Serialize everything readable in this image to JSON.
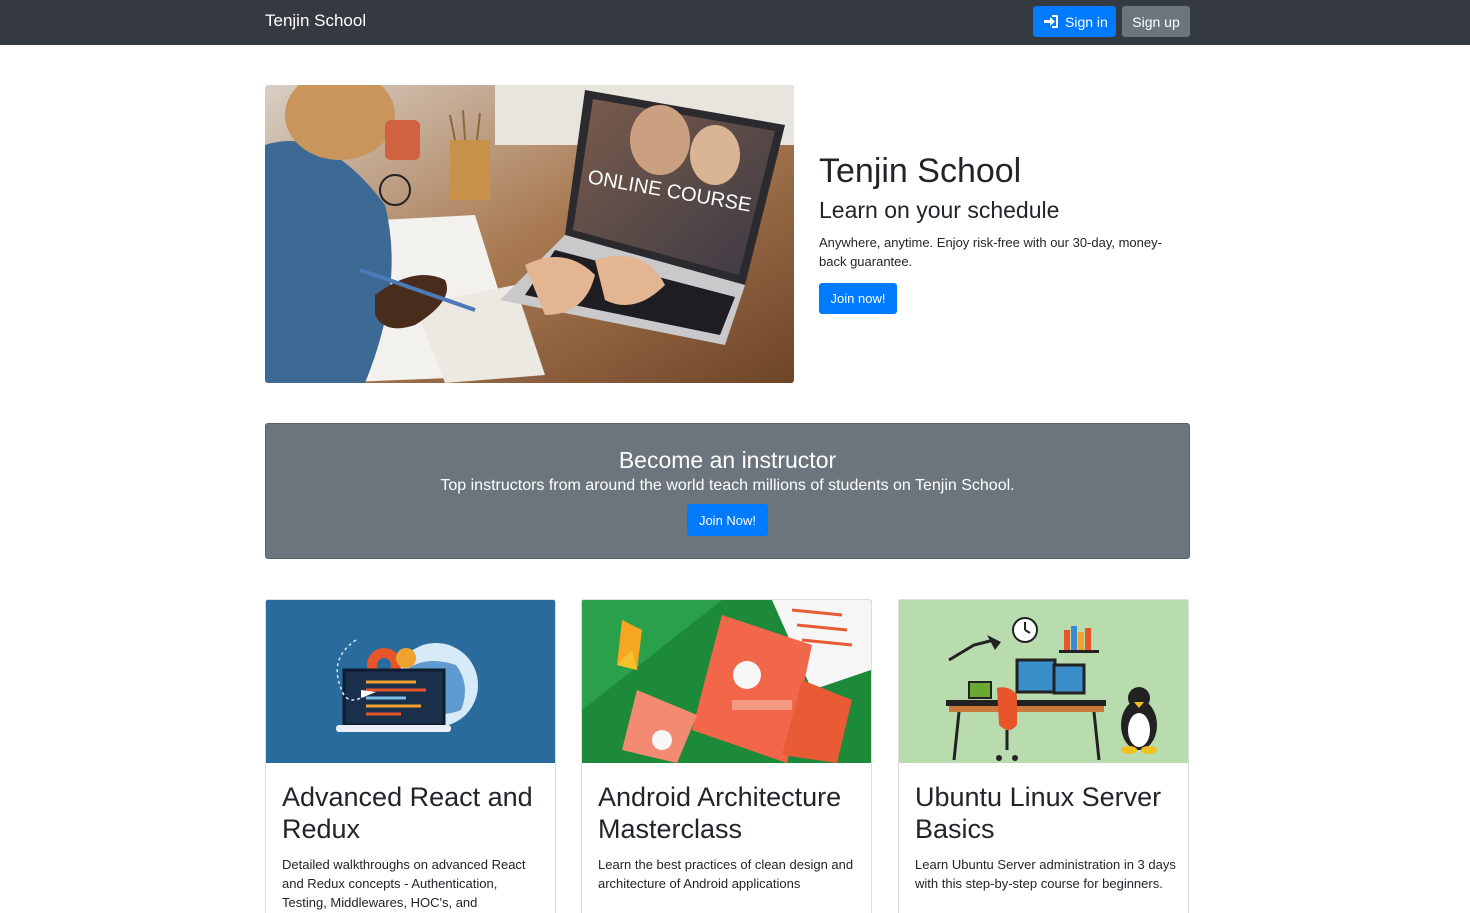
{
  "navbar": {
    "brand": "Tenjin School",
    "signin_label": "Sign in",
    "signup_label": "Sign up"
  },
  "hero": {
    "image_text": "ONLINE COURSE",
    "title": "Tenjin School",
    "subtitle": "Learn on your schedule",
    "description": "Anywhere, anytime. Enjoy risk-free with our 30-day, money-back guarantee.",
    "join_label": "Join now!"
  },
  "instructor": {
    "title": "Become an instructor",
    "description": "Top instructors from around the world teach millions of students on Tenjin School.",
    "join_label": "Join Now!"
  },
  "courses": [
    {
      "title": "Advanced React and Redux",
      "description": "Detailed walkthroughs on advanced React and Redux concepts - Authentication, Testing, Middlewares, HOC's, and",
      "image_bg": "#2a6b9e"
    },
    {
      "title": "Android Architecture Masterclass",
      "description": "Learn the best practices of clean design and architecture of Android applications",
      "image_bg": "#1d8a3a"
    },
    {
      "title": "Ubuntu Linux Server Basics",
      "description": "Learn Ubuntu Server administration in 3 days with this step-by-step course for beginners.",
      "image_bg": "#b8dcae"
    }
  ],
  "colors": {
    "navbar": "#343a40",
    "primary": "#007bff",
    "secondary": "#6c757d"
  }
}
